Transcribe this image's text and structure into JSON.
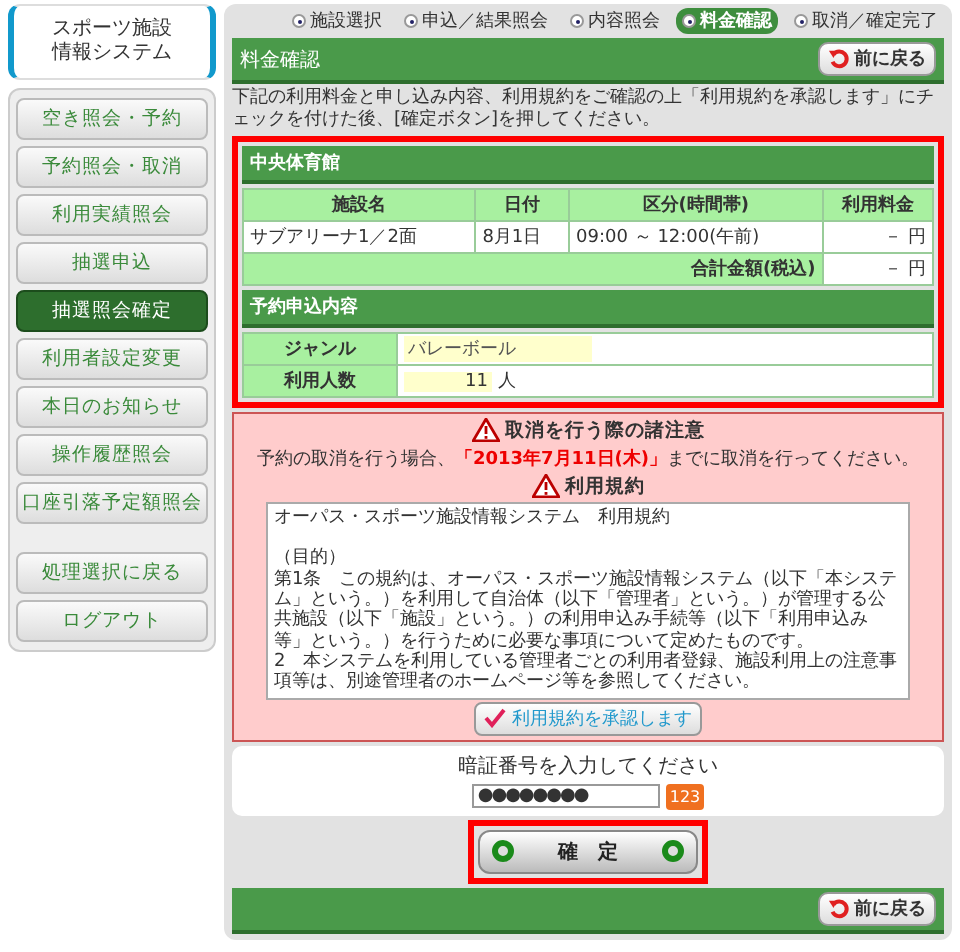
{
  "logo": {
    "lines": [
      "スポーツ施設",
      "情報システム"
    ]
  },
  "sidebar": {
    "items": [
      {
        "label": "空き照会・予約",
        "selected": false
      },
      {
        "label": "予約照会・取消",
        "selected": false
      },
      {
        "label": "利用実績照会",
        "selected": false
      },
      {
        "label": "抽選申込",
        "selected": false
      },
      {
        "label": "抽選照会確定",
        "selected": true
      },
      {
        "label": "利用者設定変更",
        "selected": false
      },
      {
        "label": "本日のお知らせ",
        "selected": false
      },
      {
        "label": "操作履歴照会",
        "selected": false
      },
      {
        "label": "口座引落予定額照会",
        "selected": false
      }
    ],
    "bottom_items": [
      {
        "label": "処理選択に戻る",
        "selected": false
      },
      {
        "label": "ログアウト",
        "selected": false
      }
    ]
  },
  "steps": [
    {
      "label": "施設選択",
      "selected": false
    },
    {
      "label": "申込／結果照会",
      "selected": false
    },
    {
      "label": "内容照会",
      "selected": false
    },
    {
      "label": "料金確認",
      "selected": true
    },
    {
      "label": "取消／確定完了",
      "selected": false
    }
  ],
  "header": {
    "title": "料金確認",
    "back_button": "前に戻る"
  },
  "description": "下記の利用料金と申し込み内容、利用規約をご確認の上「利用規約を承認します」にチェックを付けた後、[確定ボタン]を押してください。",
  "facility": {
    "title": "中央体育館",
    "highlighted": true,
    "table": {
      "columns": [
        "施設名",
        "日付",
        "区分(時間帯)",
        "利用料金"
      ],
      "rows": [
        [
          "サブアリーナ1／2面",
          "8月1日",
          "09:00 ～ 12:00(午前)",
          "－ 円"
        ]
      ],
      "total": {
        "label": "合計金額(税込)",
        "value": "－ 円"
      }
    },
    "details_title": "予約申込内容",
    "details": [
      {
        "label": "ジャンル",
        "value": "バレーボール"
      },
      {
        "label": "利用人数",
        "value": "11",
        "unit": "人"
      }
    ]
  },
  "notice": {
    "title": "取消を行う際の諸注意",
    "text": "予約の取消を行う場合、**「2013年7月11日(木)」**までに取消を行ってください。",
    "terms_title": "利用規約",
    "terms": [
      "オーパス・スポーツ施設情報システム　利用規約",
      "（目的）",
      "第1条　この規約は、オーパス・スポーツ施設情報システム（以下「本システム」という。）を利用して自治体（以下「管理者」という。）が管理する公共施設（以下「施設」という。）の利用申込み手続等（以下「利用申込み等」という。）を行うために必要な事項について定めたものです。",
      "2　本システムを利用している管理者ごとの利用者登録、施設利用上の注意事項等は、別途管理者のホームページ等を参照してください。"
    ],
    "agree_button": "利用規約を承認します"
  },
  "pin": {
    "label": "暗証番号を入力してください",
    "value": "●●●●●●●●",
    "keypad": "123"
  },
  "confirm_button": {
    "label": "確　定",
    "highlighted": true
  },
  "footer": {
    "back_button": "前に戻る"
  }
}
